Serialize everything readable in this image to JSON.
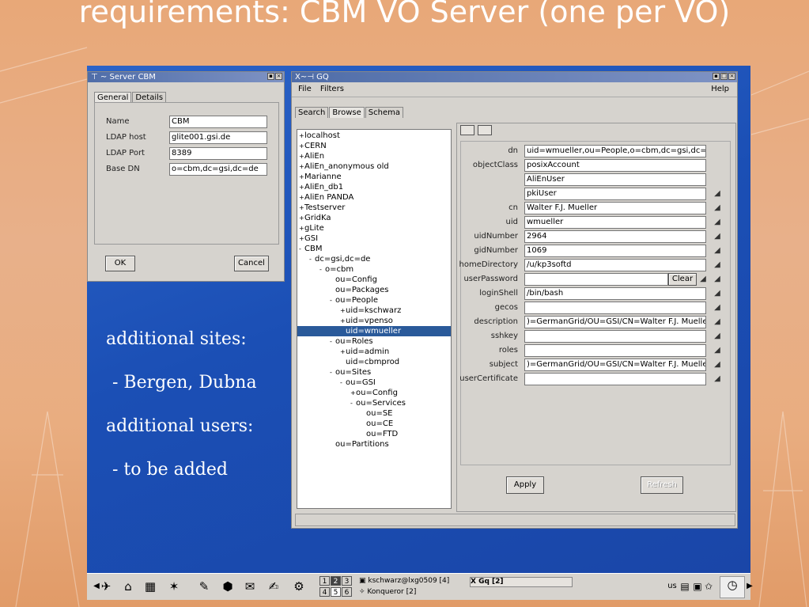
{
  "slide": {
    "title": "requirements: CBM VO Server (one per VO)",
    "notes": [
      {
        "text": "additional sites:"
      },
      {
        "text": "- Bergen, Dubna"
      },
      {
        "text": "additional users:"
      },
      {
        "text": "- to be added"
      }
    ]
  },
  "server_dialog": {
    "title": "Server CBM",
    "tabs": [
      "General",
      "Details"
    ],
    "fields": [
      {
        "label": "Name",
        "value": "CBM"
      },
      {
        "label": "LDAP host",
        "value": "glite001.gsi.de"
      },
      {
        "label": "LDAP Port",
        "value": "8389"
      },
      {
        "label": "Base DN",
        "value": "o=cbm,dc=gsi,dc=de"
      }
    ],
    "ok_label": "OK",
    "cancel_label": "Cancel"
  },
  "gq_window": {
    "title": "GQ",
    "menu": {
      "file": "File",
      "filters": "Filters",
      "help": "Help"
    },
    "tabs": [
      "Search",
      "Browse",
      "Schema"
    ],
    "tree": [
      {
        "label": "localhost",
        "exp": "+"
      },
      {
        "label": "CERN",
        "exp": "+"
      },
      {
        "label": "AliEn",
        "exp": "+"
      },
      {
        "label": "AliEn_anonymous old",
        "exp": "+"
      },
      {
        "label": "Marianne",
        "exp": "+"
      },
      {
        "label": "AliEn_db1",
        "exp": "+"
      },
      {
        "label": "AliEn PANDA",
        "exp": "+"
      },
      {
        "label": "Testserver",
        "exp": "+"
      },
      {
        "label": "GridKa",
        "exp": "+"
      },
      {
        "label": "gLite",
        "exp": "+"
      },
      {
        "label": "GSI",
        "exp": "+"
      },
      {
        "label": "CBM",
        "exp": "-"
      },
      {
        "label": "dc=gsi,dc=de",
        "exp": "-"
      },
      {
        "label": "o=cbm",
        "exp": "-"
      },
      {
        "label": "ou=Config",
        "exp": ""
      },
      {
        "label": "ou=Packages",
        "exp": ""
      },
      {
        "label": "ou=People",
        "exp": "-"
      },
      {
        "label": "uid=kschwarz",
        "exp": "+"
      },
      {
        "label": "uid=vpenso",
        "exp": "+"
      },
      {
        "label": "uid=wmueller",
        "exp": ""
      },
      {
        "label": "ou=Roles",
        "exp": "-"
      },
      {
        "label": "uid=admin",
        "exp": "+"
      },
      {
        "label": "uid=cbmprod",
        "exp": ""
      },
      {
        "label": "ou=Sites",
        "exp": "-"
      },
      {
        "label": "ou=GSI",
        "exp": "-"
      },
      {
        "label": "ou=Config",
        "exp": "+"
      },
      {
        "label": "ou=Services",
        "exp": "-"
      },
      {
        "label": "ou=SE",
        "exp": ""
      },
      {
        "label": "ou=CE",
        "exp": ""
      },
      {
        "label": "ou=FTD",
        "exp": ""
      },
      {
        "label": "ou=Partitions",
        "exp": ""
      }
    ],
    "attributes": [
      {
        "name": "dn",
        "value": "uid=wmueller,ou=People,o=cbm,dc=gsi,dc=de"
      },
      {
        "name": "objectClass",
        "value": "posixAccount"
      },
      {
        "name": "",
        "value": "AliEnUser"
      },
      {
        "name": "",
        "value": "pkiUser"
      },
      {
        "name": "cn",
        "value": "Walter F.J. Mueller"
      },
      {
        "name": "uid",
        "value": "wmueller"
      },
      {
        "name": "uidNumber",
        "value": "2964"
      },
      {
        "name": "gidNumber",
        "value": "1069"
      },
      {
        "name": "homeDirectory",
        "value": "/u/kp3softd"
      },
      {
        "name": "userPassword",
        "value": ""
      },
      {
        "name": "loginShell",
        "value": "/bin/bash"
      },
      {
        "name": "gecos",
        "value": ""
      },
      {
        "name": "description",
        "value": ")=GermanGrid/OU=GSI/CN=Walter F.J. Mueller"
      },
      {
        "name": "sshkey",
        "value": ""
      },
      {
        "name": "roles",
        "value": ""
      },
      {
        "name": "subject",
        "value": ")=GermanGrid/OU=GSI/CN=Walter F.J. Mueller"
      },
      {
        "name": "userCertificate",
        "value": ""
      }
    ],
    "clear_label": "Clear",
    "apply_label": "Apply",
    "refresh_label": "Refresh"
  },
  "taskbar": {
    "pager": [
      "1",
      "2",
      "3",
      "4",
      "5",
      "6"
    ],
    "tasks": [
      {
        "label": "kschwarz@lxg0509 [4]"
      },
      {
        "label": "Konqueror [2]"
      },
      {
        "label": "Gq [2]"
      }
    ]
  }
}
